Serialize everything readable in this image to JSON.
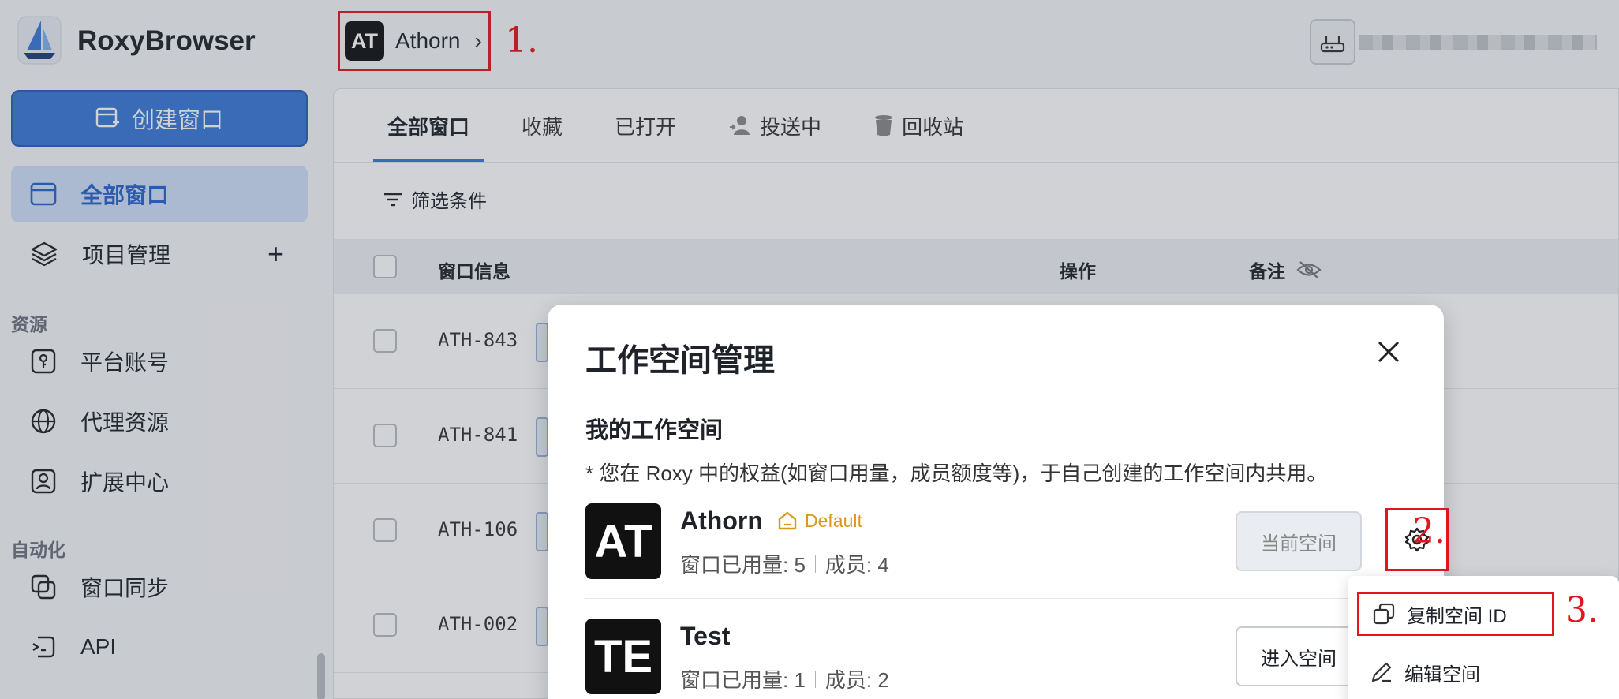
{
  "app": {
    "brand": "RoxyBrowser",
    "create_button": "创建窗口"
  },
  "sidebar": {
    "items": [
      {
        "label": "全部窗口",
        "icon": "window-icon",
        "active": true
      },
      {
        "label": "项目管理",
        "icon": "layers-icon"
      }
    ],
    "section_resources": "资源",
    "resources": [
      {
        "label": "平台账号",
        "icon": "key-icon"
      },
      {
        "label": "代理资源",
        "icon": "globe-icon"
      },
      {
        "label": "扩展中心",
        "icon": "extension-icon"
      }
    ],
    "section_automation": "自动化",
    "automation": [
      {
        "label": "窗口同步",
        "icon": "sync-icon"
      },
      {
        "label": "API",
        "icon": "api-icon"
      }
    ]
  },
  "topbar": {
    "workspace_initials": "AT",
    "workspace_name": "Athorn"
  },
  "annotations": {
    "a1": "1.",
    "a2": "2.",
    "a3": "3."
  },
  "tabs": [
    "全部窗口",
    "收藏",
    "已打开",
    "投送中",
    "回收站"
  ],
  "filter_label": "筛选条件",
  "table": {
    "columns": [
      "窗口信息",
      "操作",
      "备注"
    ],
    "rows": [
      "ATH-843",
      "ATH-841",
      "ATH-106",
      "ATH-002"
    ]
  },
  "modal": {
    "title": "工作空间管理",
    "subtitle": "我的工作空间",
    "note": "* 您在 Roxy 中的权益(如窗口用量，成员额度等)，于自己创建的工作空间内共用。",
    "workspaces": [
      {
        "initials": "AT",
        "name": "Athorn",
        "badge": "Default",
        "usage": "窗口已用量: 5",
        "members": "成员: 4",
        "button": "当前空间"
      },
      {
        "initials": "TE",
        "name": "Test",
        "usage": "窗口已用量: 1",
        "members": "成员: 2",
        "button": "进入空间"
      }
    ]
  },
  "dropdown": {
    "copy_id": "复制空间 ID",
    "edit": "编辑空间"
  },
  "colors": {
    "accent": "#3a78d8",
    "annotation": "#e3161d",
    "badge": "#d99a1c"
  }
}
